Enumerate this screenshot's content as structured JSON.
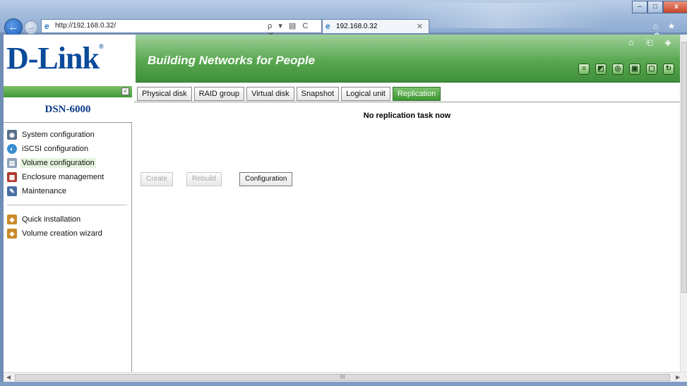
{
  "browser": {
    "url": "http://192.168.0.32/",
    "address_tools": "ρ ▾ ▤ C ✕",
    "tab_title": "192.168.0.32",
    "tab_close": "✕",
    "win_minimize": "–",
    "win_maximize": "□",
    "win_close": "x",
    "toolbar_icons": "⌂ ★ ⚙",
    "scroll_grip": "III"
  },
  "banner": {
    "logo": "D-Link",
    "logo_mark": "®",
    "slogan": "Building Networks for People",
    "top_links": [
      "home-icon",
      "exit-icon",
      "speaker-icon"
    ],
    "tools": [
      "disk-icon",
      "gear-icon",
      "network-icon",
      "save-icon",
      "monitor-icon",
      "power-icon"
    ]
  },
  "sidebar": {
    "collapse": "<",
    "model": "DSN-6000",
    "items": [
      {
        "label": "System configuration",
        "icon": "system-icon"
      },
      {
        "label": "iSCSI configuration",
        "icon": "iscsi-icon"
      },
      {
        "label": "Volume configuration",
        "icon": "volume-icon",
        "active": true
      },
      {
        "label": "Enclosure management",
        "icon": "enclosure-icon"
      },
      {
        "label": "Maintenance",
        "icon": "maintenance-icon"
      }
    ],
    "quick": [
      {
        "label": "Quick installation",
        "icon": "quick-install-icon"
      },
      {
        "label": "Volume creation wizard",
        "icon": "wizard-icon"
      }
    ]
  },
  "main": {
    "tabs": [
      "Physical disk",
      "RAID group",
      "Virtual disk",
      "Snapshot",
      "Logical unit",
      "Replication"
    ],
    "active_tab": "Replication",
    "status": "No replication task now",
    "buttons": {
      "create": "Create",
      "rebuild": "Rebuild",
      "configuration": "Configuration"
    }
  },
  "colors": {
    "banner_green": "#5aa851",
    "logo_blue": "#0a4a9a",
    "model_blue": "#0a3c8a"
  }
}
